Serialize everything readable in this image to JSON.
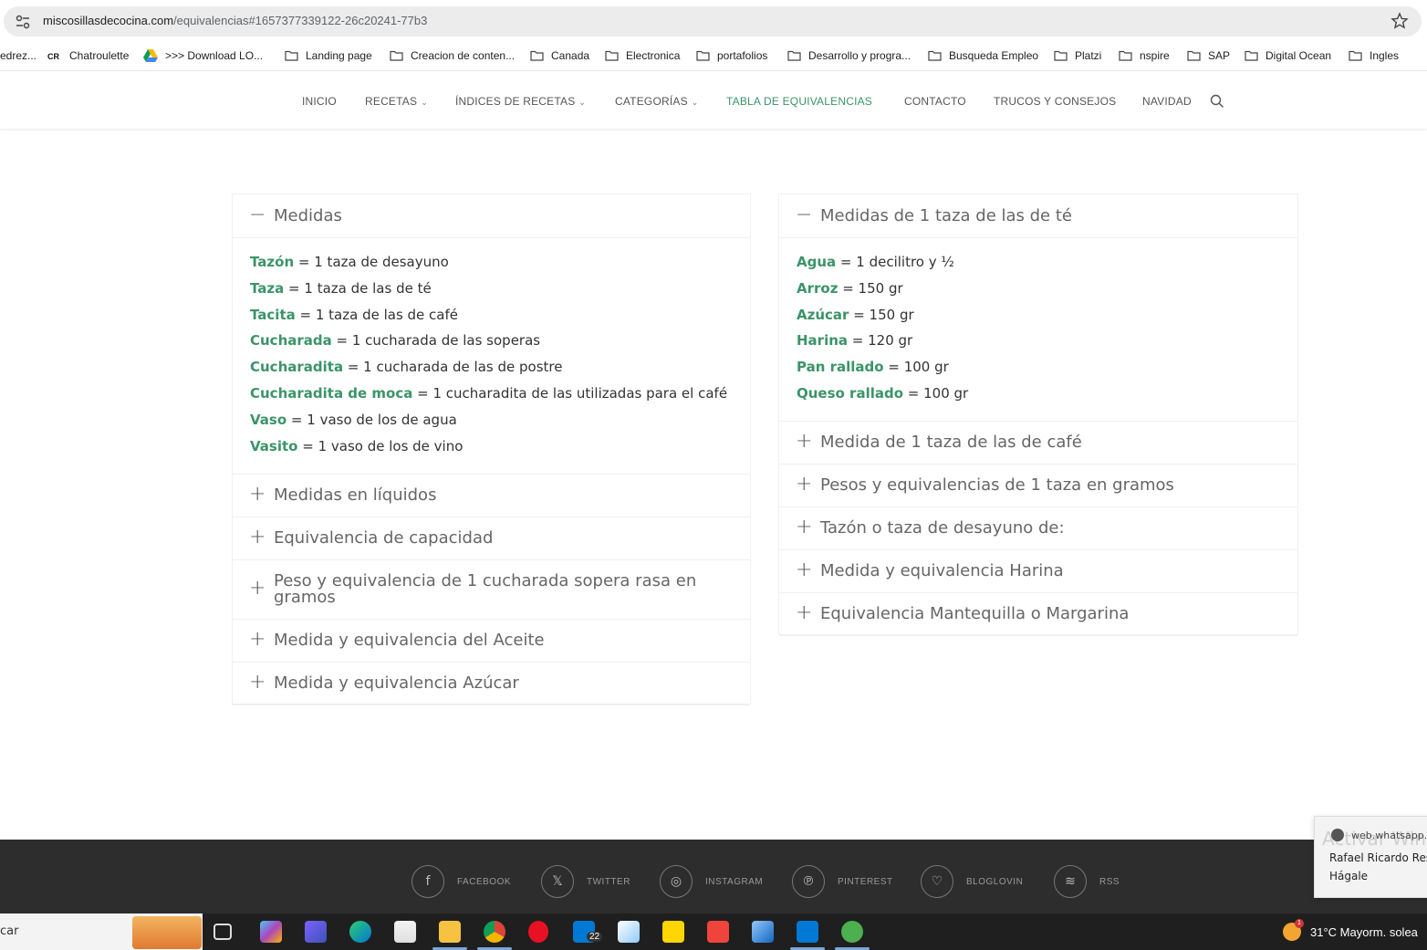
{
  "browser": {
    "url_host": "miscosillasdecocina.com",
    "url_rest": "/equivalencias#1657377339122-26c20241-77b3",
    "bookmarks": [
      {
        "label": "edrez...",
        "icon": "none"
      },
      {
        "label": "Chatroulette",
        "icon": "cr-logo"
      },
      {
        "label": ">>> Download LO...",
        "icon": "drive-icon"
      },
      {
        "label": "Landing page",
        "icon": "folder-icon"
      },
      {
        "label": "Creacion de conten...",
        "icon": "folder-icon"
      },
      {
        "label": "Canada",
        "icon": "folder-icon"
      },
      {
        "label": "Electronica",
        "icon": "folder-icon"
      },
      {
        "label": "portafolios",
        "icon": "folder-icon"
      },
      {
        "label": "Desarrollo y progra...",
        "icon": "folder-icon"
      },
      {
        "label": "Busqueda Empleo",
        "icon": "folder-icon"
      },
      {
        "label": "Platzi",
        "icon": "folder-icon"
      },
      {
        "label": "nspire",
        "icon": "folder-icon"
      },
      {
        "label": "SAP",
        "icon": "folder-icon"
      },
      {
        "label": "Digital Ocean",
        "icon": "folder-icon"
      },
      {
        "label": "Ingles",
        "icon": "folder-icon"
      }
    ]
  },
  "nav": {
    "items": [
      {
        "label": "INICIO"
      },
      {
        "label": "RECETAS",
        "caret": "⌄"
      },
      {
        "label": "ÍNDICES DE RECETAS",
        "caret": "⌄"
      },
      {
        "label": "CATEGORÍAS",
        "caret": "⌄"
      },
      {
        "label": "TABLA DE EQUIVALENCIAS"
      },
      {
        "label": "CONTACTO"
      },
      {
        "label": "TRUCOS Y CONSEJOS"
      },
      {
        "label": "NAVIDAD"
      }
    ],
    "active_color": "#3b9468"
  },
  "left": {
    "open_title": "Medidas",
    "rows": [
      {
        "term": "Tazón",
        "def": " = 1 taza de desayuno"
      },
      {
        "term": "Taza",
        "def": " = 1 taza de las de té"
      },
      {
        "term": "Tacita",
        "def": " = 1 taza de las de café"
      },
      {
        "term": "Cucharada",
        "def": " = 1 cucharada de las soperas"
      },
      {
        "term": "Cucharadita",
        "def": " = 1 cucharada de las de postre"
      },
      {
        "term": "Cucharadita de moca",
        "def": " = 1 cucharadita de las utilizadas para el café"
      },
      {
        "term": "Vaso",
        "def": " = 1 vaso de los de agua"
      },
      {
        "term": "Vasito",
        "def": " = 1 vaso de los de vino"
      }
    ],
    "closed": [
      "Medidas en líquidos",
      "Equivalencia de capacidad",
      "Peso y equivalencia de 1 cucharada sopera rasa en gramos",
      "Medida y equivalencia del Aceite",
      "Medida y equivalencia Azúcar"
    ]
  },
  "right": {
    "open_title": "Medidas de 1 taza de las de té",
    "rows": [
      {
        "term": "Agua",
        "def": " = 1 decilitro y ½"
      },
      {
        "term": "Arroz",
        "def": " = 150 gr"
      },
      {
        "term": "Azúcar",
        "def": " = 150 gr"
      },
      {
        "term": "Harina",
        "def": " = 120 gr"
      },
      {
        "term": "Pan rallado",
        "def": " = 100 gr"
      },
      {
        "term": "Queso rallado",
        "def": " = 100 gr"
      }
    ],
    "closed": [
      "Medida de 1 taza de las de café",
      "Pesos y equivalencias de 1 taza en gramos",
      "Tazón o taza de desayuno de:",
      "Medida y equivalencia Harina",
      "Equivalencia Mantequilla o Margarina"
    ]
  },
  "accordion_symbols": {
    "open": "−",
    "closed": "+"
  },
  "footer": {
    "social": [
      {
        "icon": "f",
        "label": "FACEBOOK"
      },
      {
        "icon": "𝕏",
        "label": "TWITTER"
      },
      {
        "icon": "◎",
        "label": "INSTAGRAM"
      },
      {
        "icon": "℗",
        "label": "PINTEREST"
      },
      {
        "icon": "♡",
        "label": "BLOGLOVIN"
      },
      {
        "icon": "≋",
        "label": "RSS"
      }
    ]
  },
  "toast": {
    "watermark": "Activar Windo",
    "site": "web.whatsapp.c",
    "sender": "Rafael Ricardo Rest",
    "message": "Hágale"
  },
  "taskbar": {
    "search_text": "car",
    "mail_badge": "22",
    "weather_badge": "1",
    "weather": "31°C  Mayorm. solea"
  }
}
